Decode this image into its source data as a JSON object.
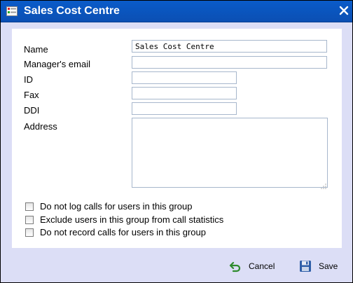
{
  "window": {
    "title": "Sales Cost Centre",
    "title_icon": "form-window-icon",
    "close_icon": "close-icon"
  },
  "form": {
    "fields": [
      {
        "label": "Name",
        "value": "Sales Cost Centre"
      },
      {
        "label": "Manager's email",
        "value": ""
      },
      {
        "label": "ID",
        "value": ""
      },
      {
        "label": "Fax",
        "value": ""
      },
      {
        "label": "DDI",
        "value": ""
      },
      {
        "label": "Address",
        "value": ""
      }
    ],
    "checkboxes": [
      {
        "label": "Do not log calls for users in this group",
        "checked": false
      },
      {
        "label": "Exclude users in this group from call statistics",
        "checked": false
      },
      {
        "label": "Do not record calls for users in this group",
        "checked": false
      }
    ]
  },
  "footer": {
    "cancel_label": "Cancel",
    "cancel_icon": "undo-arrow-icon",
    "save_label": "Save",
    "save_icon": "floppy-disk-icon"
  },
  "colors": {
    "titlebar": "#0b56c0",
    "dialog_bg": "#dcdef6",
    "field_border": "#a7b7cc"
  }
}
